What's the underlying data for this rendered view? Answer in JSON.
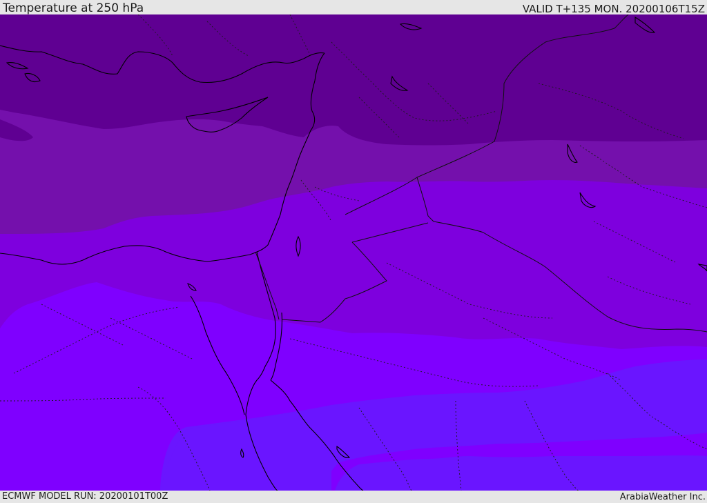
{
  "header": {
    "title": "Temperature at 250 hPa",
    "valid": "VALID T+135 MON. 20200106T15Z"
  },
  "footer": {
    "model_run": "ECMWF MODEL RUN: 20200101T00Z",
    "credit": "ArabiaWeather Inc."
  },
  "map": {
    "field": "Temperature at 250 hPa",
    "band_colors": {
      "coldest": "#5f0092",
      "cold": "#7410ac",
      "cool": "#7e00de",
      "mild": "#7f00ff",
      "warm_core": "#6a15ff"
    },
    "coastline_color": "#000000",
    "border_color": "#101010"
  }
}
